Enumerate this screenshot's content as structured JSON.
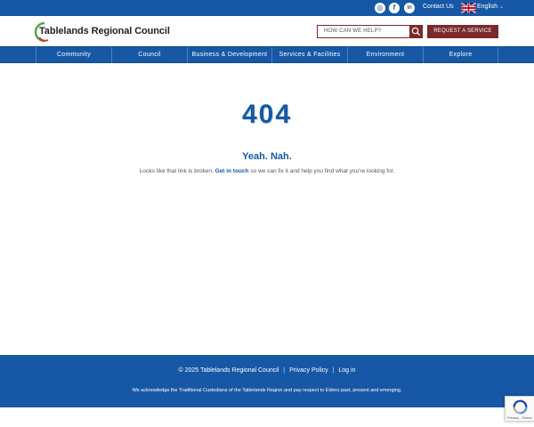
{
  "topbar": {
    "contact_label": "Contact Us",
    "language_label": "English",
    "language_caret": "⌄",
    "social": [
      {
        "icon": "instagram-icon",
        "glyph": "◎"
      },
      {
        "icon": "facebook-icon",
        "glyph": "f"
      },
      {
        "icon": "linkedin-icon",
        "glyph": "in"
      }
    ]
  },
  "header": {
    "site_name": "Tablelands Regional Council",
    "search_placeholder": "HOW CAN WE HELP?",
    "request_label": "REQUEST A SERVICE"
  },
  "nav": {
    "items": [
      "Community",
      "Council",
      "Business & Development",
      "Services & Facilities",
      "Environment",
      "Explore"
    ]
  },
  "main": {
    "code": "404",
    "title": "Yeah. Nah.",
    "message_before": "Looks like that link is broken.",
    "message_link": "Get in touch",
    "message_after": "so we can fix it and help you find what you're looking for."
  },
  "footer": {
    "copyright": "© 2025 Tablelands Regional Council",
    "privacy_label": "Privacy Policy",
    "login_label": "Log in",
    "separator": "|",
    "acknowledgement": "We acknowledge the Traditional Custodians of the Tablelands Region and pay respect to Elders past, present and emerging."
  },
  "recaptcha": {
    "legal": "Privacy - Terms"
  },
  "colors": {
    "brand_blue": "#1658a6",
    "accent_maroon": "#7a2a2a"
  }
}
